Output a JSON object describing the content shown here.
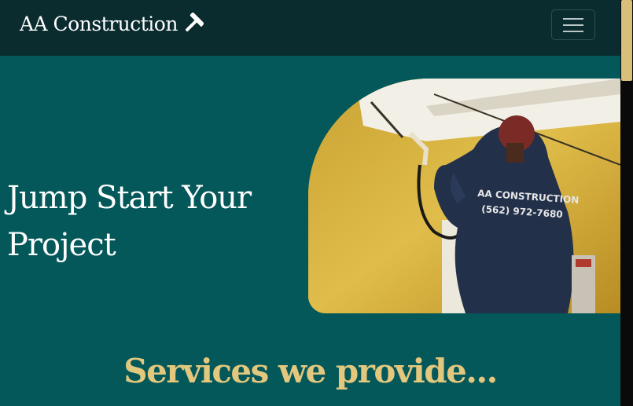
{
  "navbar": {
    "brand": "AA Construction",
    "brand_icon": "hammer-icon",
    "toggler_icon": "hamburger-menu-icon"
  },
  "hero": {
    "title_line1": "Jump Start Your",
    "title_line2": "Project",
    "image_shirt_text_1": "AA CONSTRUCTION",
    "image_shirt_text_2": "(562) 972-7680"
  },
  "services": {
    "heading": "Services we provide..."
  },
  "colors": {
    "background": "#04585a",
    "navbar": "#0b2c2f",
    "accent": "#e2c77d"
  }
}
